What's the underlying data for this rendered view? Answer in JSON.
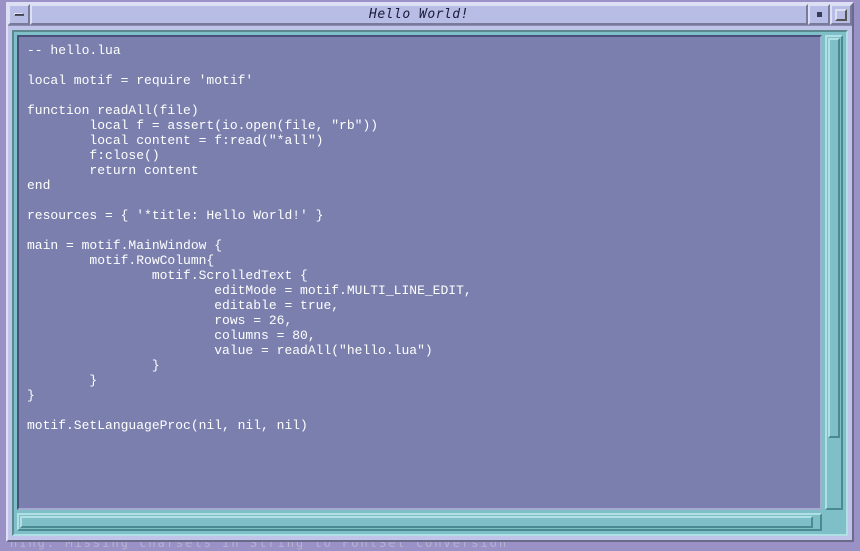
{
  "window": {
    "title": "Hello World!"
  },
  "editor": {
    "content": "-- hello.lua\n\nlocal motif = require 'motif'\n\nfunction readAll(file)\n        local f = assert(io.open(file, \"rb\"))\n        local content = f:read(\"*all\")\n        f:close()\n        return content\nend\n\nresources = { '*title: Hello World!' }\n\nmain = motif.MainWindow {\n        motif.RowColumn{\n                motif.ScrolledText {\n                        editMode = motif.MULTI_LINE_EDIT,\n                        editable = true,\n                        rows = 26,\n                        columns = 80,\n                        value = readAll(\"hello.lua\")\n                }\n        }\n}\n\nmotif.SetLanguageProc(nil, nil, nil)"
  },
  "background": {
    "partial_text": "ning: Missing charsets in String to FontSet conversion"
  }
}
